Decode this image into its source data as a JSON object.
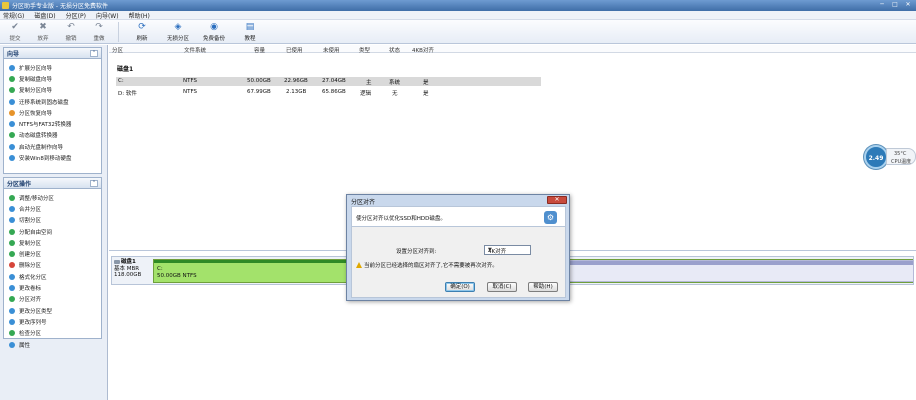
{
  "window": {
    "title": "分区助手专业版 - 无损分区免费软件",
    "buttons": [
      "─",
      "□",
      "✕"
    ]
  },
  "menu": [
    "常规(G)",
    "磁盘(D)",
    "分区(P)",
    "向导(W)",
    "帮助(H)"
  ],
  "toolbar": {
    "tools": [
      {
        "label": "提交",
        "icon": "commit-icon"
      },
      {
        "label": "放弃",
        "icon": "discard-icon"
      },
      {
        "label": "撤销",
        "icon": "undo-icon"
      },
      {
        "label": "重做",
        "icon": "redo-icon"
      }
    ],
    "big_tools": [
      {
        "label": "刷新",
        "icon": "refresh-icon"
      },
      {
        "label": "无损分区",
        "icon": "lossless-partition-icon"
      },
      {
        "label": "免费备份",
        "icon": "free-backup-icon"
      },
      {
        "label": "教程",
        "icon": "tutorial-icon"
      }
    ]
  },
  "wizard_panel": {
    "title": "向导",
    "items": [
      "扩展分区向导",
      "复制磁盘向导",
      "复制分区向导",
      "迁移系统到固态磁盘",
      "分区恢复向导",
      "NTFS与FAT32转换器",
      "动态磁盘转换器",
      "启动光盘制作向导",
      "安装Win8到移动硬盘"
    ]
  },
  "ops_panel": {
    "title": "分区操作",
    "items": [
      "调整/移动分区",
      "合并分区",
      "切割分区",
      "分配自由空间",
      "复制分区",
      "创建分区",
      "删除分区",
      "格式化分区",
      "更改卷标",
      "分区对齐",
      "更改分区类型",
      "更改序列号",
      "检查分区",
      "属性"
    ]
  },
  "table": {
    "columns": [
      "分区",
      "文件系统",
      "容量",
      "已使用",
      "未使用",
      "类型",
      "状态",
      "4KB对齐"
    ],
    "disk_label": "磁盘1",
    "rows": [
      {
        "partition": "C:",
        "fs": "NTFS",
        "capacity": "50.00GB",
        "used": "22.96GB",
        "free": "27.04GB",
        "type": "主",
        "status": "系统",
        "aligned": "是"
      },
      {
        "partition": "D: 软件",
        "fs": "NTFS",
        "capacity": "67.99GB",
        "used": "2.13GB",
        "free": "65.86GB",
        "type": "逻辑",
        "status": "无",
        "aligned": "是"
      }
    ]
  },
  "diskmap": {
    "title": "磁盘1",
    "type": "基本 MBR",
    "size": "118.00GB",
    "partition_name": "C:",
    "partition_info": "50.00GB NTFS",
    "used_fraction": 0.46
  },
  "gauge": {
    "value": "2.49",
    "temp": "35°C",
    "label": "CPU温度"
  },
  "dialog": {
    "title": "分区对齐",
    "close": "✕",
    "header_text": "使分区对齐以优化SSD和HDD磁盘。",
    "align_label": "设置分区对齐到:",
    "align_value": "4K对齐",
    "warning": "当前分区已经选择的扇区对齐了,它不需要被再次对齐。",
    "ok": "确定(O)",
    "cancel": "取消(C)",
    "help": "帮助(H)"
  },
  "colors": {
    "titlebar": "#3f6ea7",
    "partition_green": "#a3e26b",
    "selection": "#d9d9d9"
  }
}
